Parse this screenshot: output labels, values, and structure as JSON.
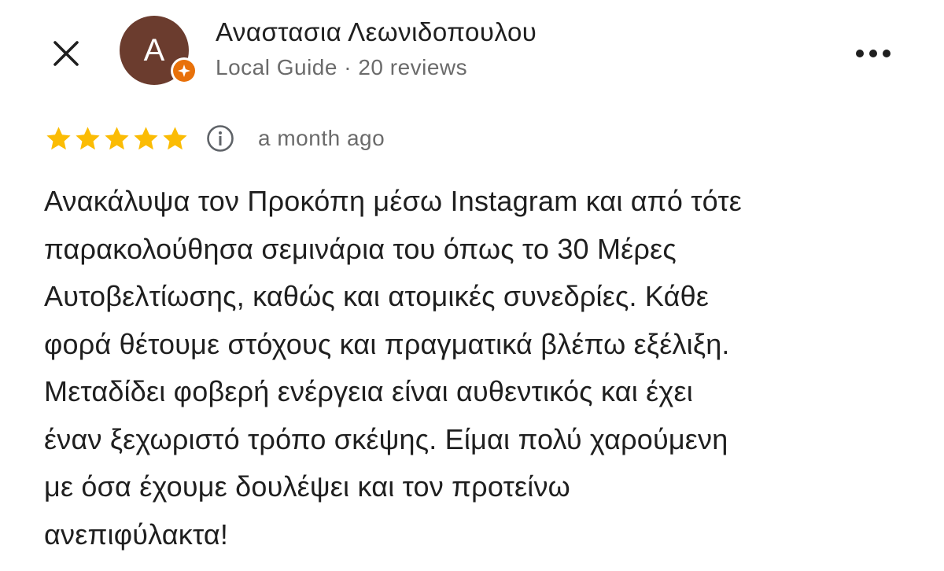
{
  "header": {
    "close_icon": "close-icon",
    "more_icon": "more-horizontal-icon"
  },
  "author": {
    "avatar_initial": "A",
    "avatar_color": "#6b3c2e",
    "badge_icon": "local-guide-star-icon",
    "badge_color": "#e8710a",
    "name": "Αναστασια Λεωνιδοπουλου",
    "meta": "Local Guide · 20 reviews"
  },
  "review": {
    "rating": 5,
    "rating_max": 5,
    "star_color": "#fbbc04",
    "info_icon": "info-icon",
    "timestamp": "a month ago",
    "lines": [
      "Ανακάλυψα τον Προκόπη μέσω Instagram και από τότε",
      "παρακολούθησα σεμινάρια του όπως το 30 Μέρες",
      "Αυτοβελτίωσης, καθώς και ατομικές συνεδρίες. Κάθε",
      "φορά θέτουμε στόχους και πραγματικά βλέπω εξέλιξη.",
      "Μεταδίδει φοβερή ενέργεια είναι αυθεντικός και έχει",
      "έναν ξεχωριστό τρόπο σκέψης. Είμαι πολύ χαρούμενη",
      "με όσα έχουμε δουλέψει και τον προτείνω",
      "ανεπιφύλακτα!"
    ]
  }
}
